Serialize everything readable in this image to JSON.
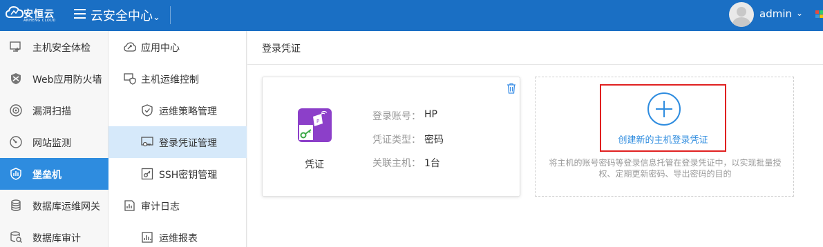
{
  "header": {
    "brand": "安恒云",
    "brand_sub": "ANHENG CLOUD",
    "app_title": "云安全中心",
    "username": "admin"
  },
  "sidebar": {
    "items": [
      {
        "label": "主机安全体检",
        "icon": "host-check-icon"
      },
      {
        "label": "Web应用防火墙",
        "icon": "shield-icon"
      },
      {
        "label": "漏洞扫描",
        "icon": "scan-icon"
      },
      {
        "label": "网站监测",
        "icon": "gauge-icon"
      },
      {
        "label": "堡垒机",
        "icon": "bastion-shield-icon",
        "active": true
      },
      {
        "label": "数据库运维网关",
        "icon": "database-icon"
      },
      {
        "label": "数据库审计",
        "icon": "database-search-icon"
      }
    ]
  },
  "submenu": {
    "items": [
      {
        "label": "应用中心",
        "icon": "app-center-icon"
      },
      {
        "label": "主机运维控制",
        "icon": "monitor-shield-icon"
      },
      {
        "label": "运维策略管理",
        "icon": "policy-shield-icon"
      },
      {
        "label": "登录凭证管理",
        "icon": "credential-icon",
        "active": true
      },
      {
        "label": "SSH密钥管理",
        "icon": "key-icon"
      },
      {
        "label": "审计日志",
        "icon": "log-icon"
      },
      {
        "label": "运维报表",
        "icon": "report-icon"
      }
    ]
  },
  "main": {
    "title": "登录凭证",
    "credential_card": {
      "name": "凭证",
      "account_label": "登录账号：",
      "account_value": "HP",
      "type_label": "凭证类型：",
      "type_value": "密码",
      "hosts_label": "关联主机：",
      "hosts_value": "1台"
    },
    "create_card": {
      "label": "创建新的主机登录凭证",
      "description": "将主机的账号密码等登录信息托管在登录凭证中，以实现批量授权、定期更新密码、导出密码的目的"
    }
  },
  "colors": {
    "header_bg": "#1a6fc4",
    "accent": "#2e8cdf",
    "active_submenu": "#d6e9fa",
    "highlight_box": "#e02020",
    "credential_icon": "#8c3fc9"
  }
}
